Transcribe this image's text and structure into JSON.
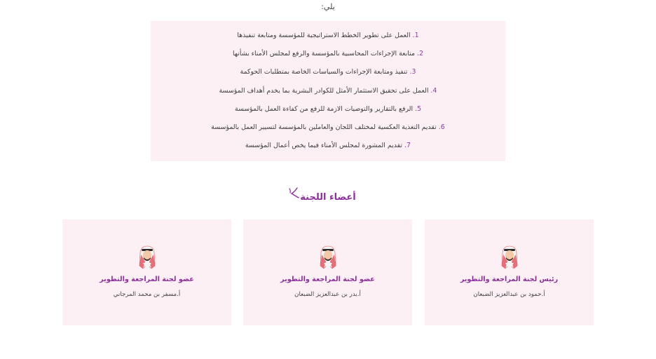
{
  "intro": {
    "tail_text": "يلي:"
  },
  "tasks": [
    {
      "num": "1.",
      "text": "العمل على تطوير الخطط الاستراتيجية للمؤسسة ومتابعة تنفيذها"
    },
    {
      "num": "2.",
      "text": "متابعة الإجراءات المحاسبية بالمؤسسة والرفع لمجلس الأمناء بشأنها"
    },
    {
      "num": "3.",
      "text": "تنفيذ ومتابعة الإجراءات والسياسات الخاصة بمتطلبات الحوكمة"
    },
    {
      "num": "4.",
      "text": "العمل على تحقيق الاستثمار الأمثل للكوادر البشرية بما يخدم أهداف المؤسسة"
    },
    {
      "num": "5.",
      "text": "الرفع بالتقارير والتوصيات الازمة للرفع من كفاءة العمل بالمؤسسة"
    },
    {
      "num": "6.",
      "text": "تقديم التغذية العكسية لمختلف اللجان والعاملين بالمؤسسة لتسيير العمل بالمؤسسة"
    },
    {
      "num": "7.",
      "text": "تقديم المشورة لمجلس الأمناء فيما يخص أعمال المؤسسة"
    }
  ],
  "members_section": {
    "title": "أعضاء اللجنة"
  },
  "members": [
    {
      "role": "رئيس لجنة المراجعة والتطوير",
      "name": "أ.حمود بن عبدالعزيز الضبعان",
      "icon": "man-ghutra-avatar-icon"
    },
    {
      "role": "عضو لجنة المراجعة والتطوير",
      "name": "أ.بدر بن عبدالعزيز الضبعان",
      "icon": "man-ghutra-avatar-icon"
    },
    {
      "role": "عضو لجنة المراجعة والتطوير",
      "name": "أ.مسفر بن محمد المرجاني",
      "icon": "man-ghutra-avatar-icon"
    }
  ],
  "colors": {
    "accent": "#8c2f9a",
    "card_bg": "#fdf0f5",
    "ghutra_red": "#e8555f",
    "skin": "#f3c9a8"
  }
}
